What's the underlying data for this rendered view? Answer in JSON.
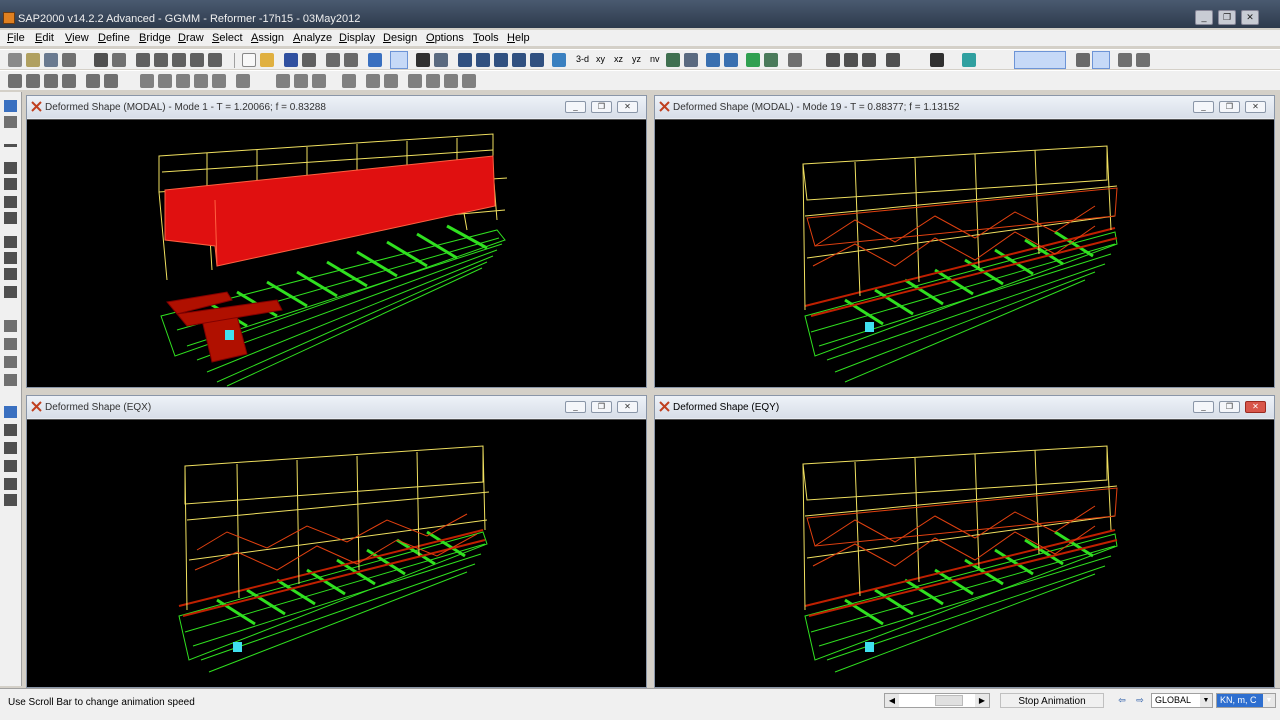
{
  "app": {
    "title": "SAP2000 v14.2.2 Advanced  - GGMM - Reformer -17h15 - 03May2012"
  },
  "menu": [
    "File",
    "Edit",
    "View",
    "Define",
    "Bridge",
    "Draw",
    "Select",
    "Assign",
    "Analyze",
    "Display",
    "Design",
    "Options",
    "Tools",
    "Help"
  ],
  "toolbar": {
    "view_labels": [
      "3-d",
      "xy",
      "xz",
      "yz",
      "nv"
    ]
  },
  "windows": [
    {
      "title": "Deformed Shape (MODAL) - Mode 1 - T = 1.20066;  f = 0.83288",
      "active": false
    },
    {
      "title": "Deformed Shape (MODAL) - Mode 19 - T = 0.88377;  f = 1.13152",
      "active": false
    },
    {
      "title": "Deformed Shape (EQX)",
      "active": false
    },
    {
      "title": "Deformed Shape (EQY)",
      "active": true
    }
  ],
  "window_controls": {
    "minimize": "_",
    "restore": "❐",
    "close": "✕"
  },
  "status": {
    "message": "Use Scroll Bar to change animation speed",
    "stop_animation": "Stop Animation",
    "coord_system": "GLOBAL",
    "units": "KN, m, C"
  },
  "colors": {
    "structure_top": "#f0e060",
    "structure_mid": "#e04010",
    "base_green": "#30e020",
    "deformed_fill": "#e01010",
    "support_marker": "#40e0f0",
    "viewport_bg": "#000000"
  }
}
